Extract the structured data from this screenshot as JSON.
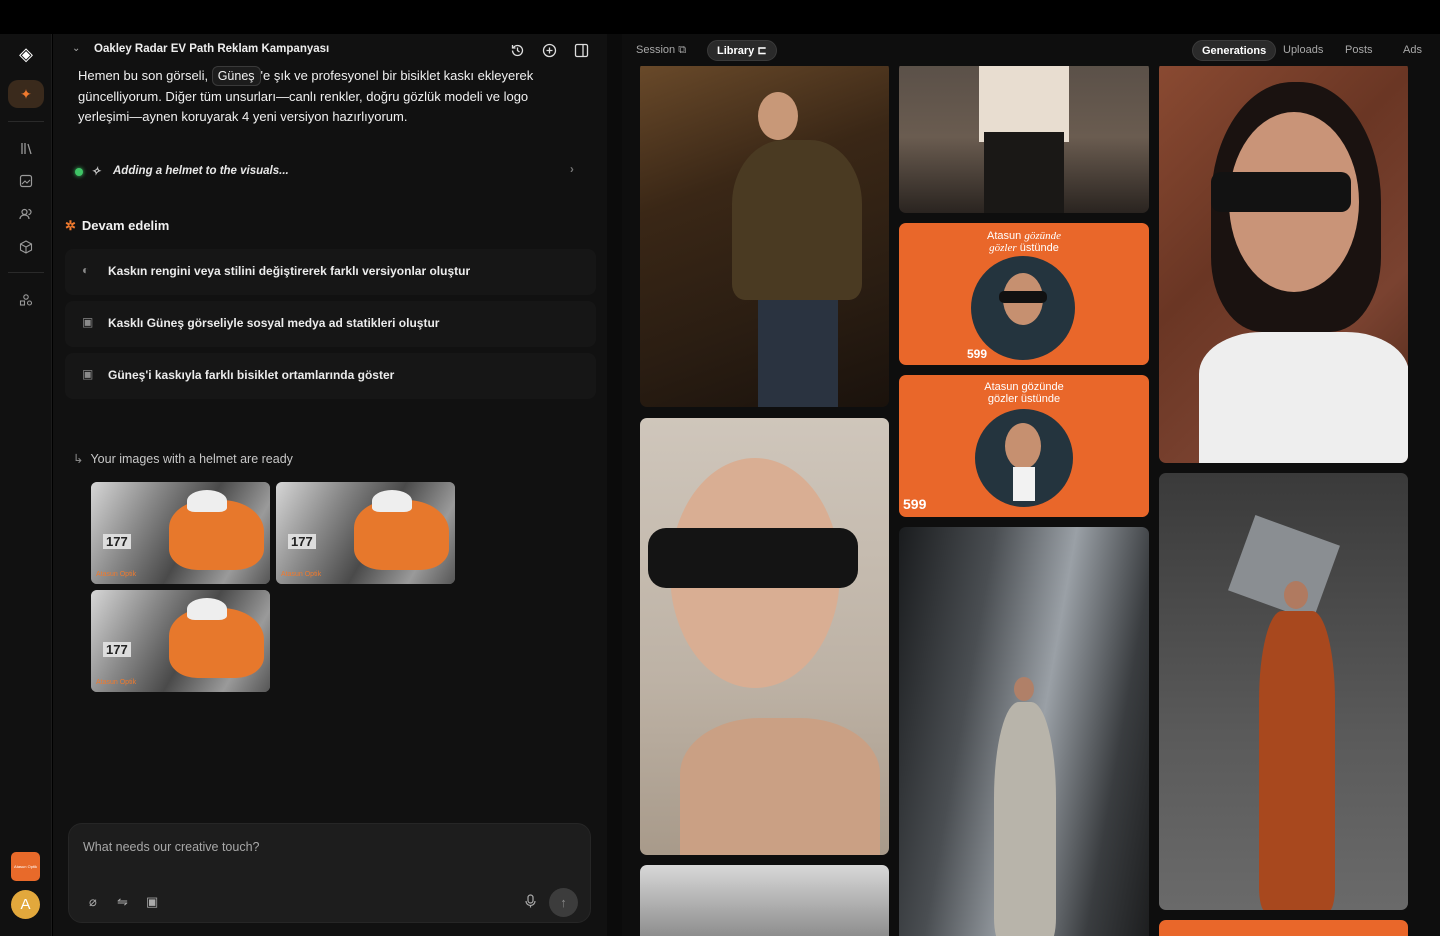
{
  "chat": {
    "title": "Oakley Radar EV Path Reklam Kampanyası",
    "message_before": "Hemen bu son görseli,",
    "chip": "Güneş",
    "message_after": "'e şık ve profesyonel bir bisiklet kaskı ekleyerek güncelliyorum. Diğer tüm unsurları—canlı renkler, doğru gözlük modeli ve logo yerleşimi—aynen koruyarak 4 yeni versiyon hazırlıyorum.",
    "status": "Adding a helmet to the visuals...",
    "continue_heading": "Devam edelim",
    "suggestions": [
      {
        "icon": "palette-icon",
        "label": "Kaskın rengini veya stilini değiştirerek farklı versiyonlar oluştur"
      },
      {
        "icon": "image-icon",
        "label": "Kasklı Güneş görseliyle sosyal medya ad statikleri oluştur"
      },
      {
        "icon": "image-icon",
        "label": "Güneş'i kaskıyla farklı bisiklet ortamlarında göster"
      }
    ],
    "ready_text": "Your images with a helmet are ready",
    "thumbs": [
      {
        "number": "177",
        "watermark": "Atasun Optik"
      },
      {
        "number": "177",
        "watermark": "Atasun Optik"
      },
      {
        "number": "177",
        "watermark": "Atasun Optik"
      }
    ],
    "composer_placeholder": "What needs our creative touch?"
  },
  "rail": {
    "brand_text": "Atasun Optik",
    "user_initial": "A"
  },
  "gallery": {
    "left_tabs": [
      "Session",
      "Library"
    ],
    "active_left_tab": "Library",
    "right_tabs": [
      "Generations",
      "Uploads",
      "Posts",
      "Ads"
    ],
    "active_right_tab": "Generations",
    "ad1": {
      "line1": "Atasun",
      "line1_script": "gözünde",
      "line2_script": "gözler",
      "line2": "üstünde",
      "price": "599"
    },
    "ad2": {
      "line1": "Atasun gözünde",
      "line2": "gözler üstünde",
      "price": "599"
    }
  },
  "colors": {
    "accent": "#f07a2e",
    "ad_orange": "#e9672a",
    "status_green": "#3fc466",
    "background": "#111111"
  }
}
